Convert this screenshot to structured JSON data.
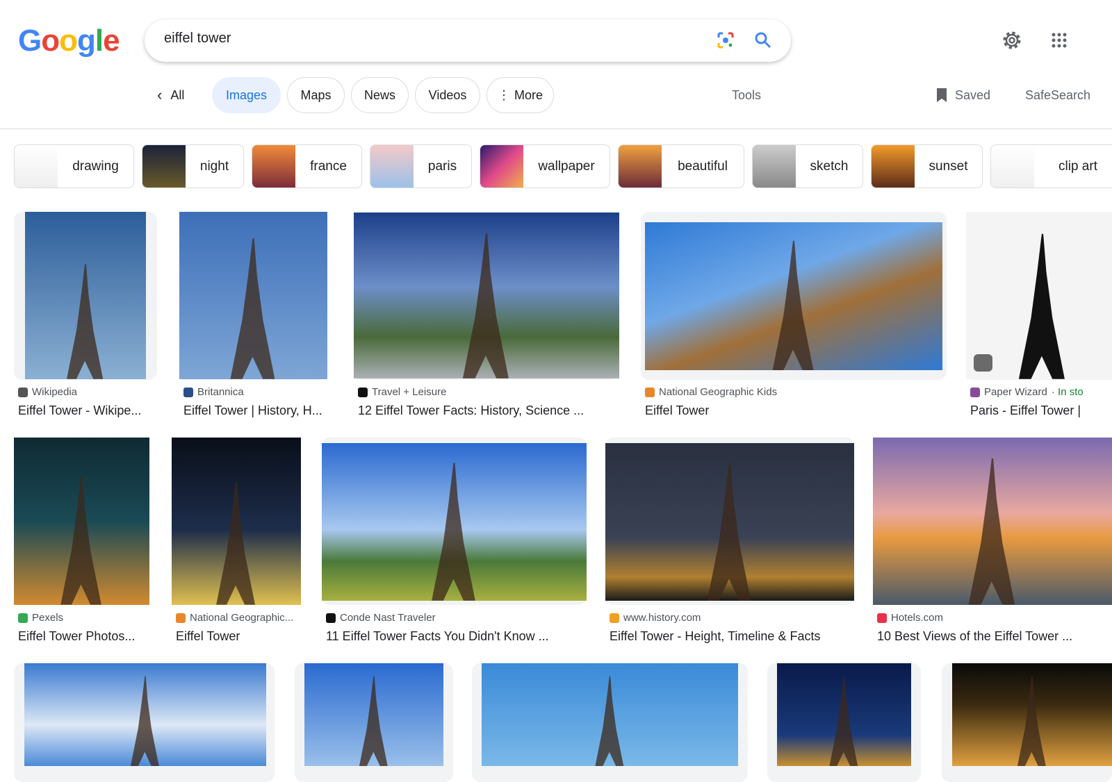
{
  "header": {
    "logo": "Google",
    "query": "eiffel tower",
    "lens_icon": "google-lens-icon",
    "search_icon": "search-icon",
    "settings_icon": "gear-icon",
    "apps_icon": "apps-grid-icon"
  },
  "tabs": {
    "back_all": "All",
    "items": [
      "Images",
      "Maps",
      "News",
      "Videos",
      "More"
    ],
    "active": "Images",
    "tools": "Tools",
    "saved": "Saved",
    "safesearch": "SafeSearch"
  },
  "chips": [
    "drawing",
    "night",
    "france",
    "paris",
    "wallpaper",
    "beautiful",
    "sketch",
    "sunset",
    "clip art"
  ],
  "results": [
    {
      "source": "Wikipedia",
      "title": "Eiffel Tower - Wikipe..."
    },
    {
      "source": "Britannica",
      "title": "Eiffel Tower | History, H..."
    },
    {
      "source": "Travel + Leisure",
      "title": "12 Eiffel Tower Facts: History, Science ..."
    },
    {
      "source": "National Geographic Kids",
      "title": "Eiffel Tower"
    },
    {
      "source": "Paper Wizard",
      "stock": "· In sto",
      "title": "Paris - Eiffel Tower |"
    },
    {
      "source": "Pexels",
      "title": "Eiffel Tower Photos..."
    },
    {
      "source": "National Geographic...",
      "title": "Eiffel Tower"
    },
    {
      "source": "Conde Nast Traveler",
      "title": "11 Eiffel Tower Facts You Didn't Know ..."
    },
    {
      "source": "www.history.com",
      "title": "Eiffel Tower - Height, Timeline & Facts"
    },
    {
      "source": "Hotels.com",
      "title": "10 Best Views of the Eiffel Tower ..."
    },
    {},
    {},
    {},
    {},
    {}
  ],
  "colors": {
    "accent": "#1a73e8",
    "active_tab_bg": "#e8f0fe",
    "stock_green": "#188038"
  }
}
